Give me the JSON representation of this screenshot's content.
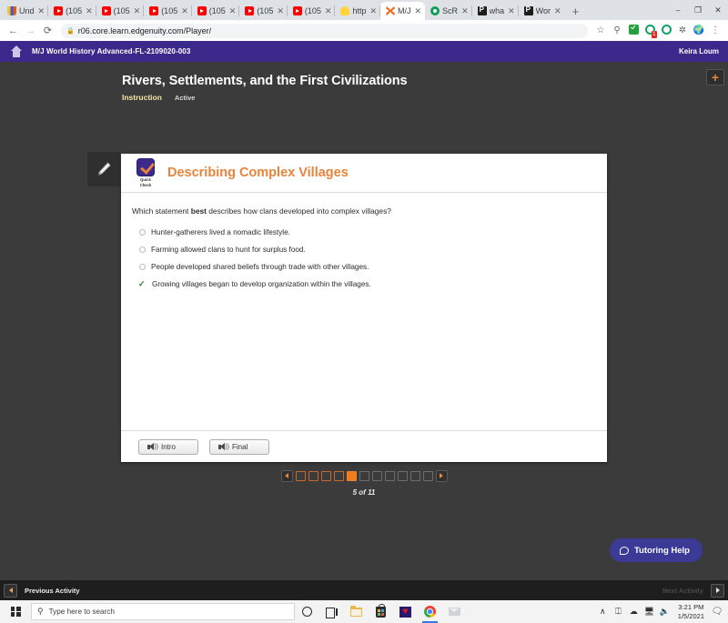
{
  "browser": {
    "tabs": [
      {
        "title": "Und",
        "favicon": "shopping-bag-icon",
        "active": false
      },
      {
        "title": "(105",
        "favicon": "youtube-icon",
        "active": false
      },
      {
        "title": "(105",
        "favicon": "youtube-icon",
        "active": false
      },
      {
        "title": "(105",
        "favicon": "youtube-icon",
        "active": false
      },
      {
        "title": "(105",
        "favicon": "youtube-icon",
        "active": false
      },
      {
        "title": "(105",
        "favicon": "youtube-icon",
        "active": false
      },
      {
        "title": "(105",
        "favicon": "youtube-icon",
        "active": false
      },
      {
        "title": "http",
        "favicon": "lightbulb-icon",
        "active": false
      },
      {
        "title": "M/J",
        "favicon": "edgenuity-icon",
        "active": true
      },
      {
        "title": "ScR",
        "favicon": "grammarly-icon",
        "active": false
      },
      {
        "title": "wha",
        "favicon": "pear-deck-icon",
        "active": false
      },
      {
        "title": "Wor",
        "favicon": "pear-deck-icon",
        "active": false
      }
    ],
    "new_tab_label": "+",
    "close_glyph": "✕",
    "window_controls": {
      "minimize": "–",
      "maximize": "❐",
      "close": "✕"
    },
    "nav": {
      "back": "←",
      "forward": "→",
      "reload": "⟳"
    },
    "omnibox": {
      "url": "r06.core.learn.edgenuity.com/Player/",
      "lock": "🔒"
    },
    "toolbar_icons": [
      "star-icon",
      "lens-icon",
      "green-check-extension-icon",
      "extension-badge-icon",
      "grammarly-extension-icon",
      "extensions-puzzle-icon",
      "profile-avatar-icon",
      "chrome-menu-icon"
    ],
    "extension_badge_count": "1"
  },
  "app": {
    "header": {
      "home_icon": "home-icon",
      "course_name": "M/J World History Advanced-FL-2109020-003",
      "user_name": "Keira Loum"
    },
    "lesson": {
      "title": "Rivers, Settlements, and the First Civilizations",
      "tabs": [
        {
          "label": "Instruction",
          "active": true
        },
        {
          "label": "Active",
          "active": false
        }
      ]
    },
    "add_button_label": "+",
    "pencil_tool": "pencil-icon",
    "card": {
      "badge_line1": "Quick",
      "badge_line2": "Check",
      "title": "Describing Complex Villages",
      "question_prefix": "Which statement ",
      "question_bold": "best",
      "question_suffix": " describes how clans developed into complex villages?",
      "options": [
        {
          "label": "Hunter-gatherers lived a nomadic lifestyle.",
          "state": "unselected"
        },
        {
          "label": "Farming allowed clans to hunt for surplus food.",
          "state": "unselected"
        },
        {
          "label": "People developed shared beliefs through trade with other villages.",
          "state": "unselected"
        },
        {
          "label": "Growing villages began to develop organization within the villages.",
          "state": "correct"
        }
      ],
      "footer_buttons": [
        {
          "label": "Intro",
          "icon": "speaker-icon"
        },
        {
          "label": "Final",
          "icon": "speaker-icon"
        }
      ]
    },
    "pager": {
      "prev_arrow": "prev-page-arrow",
      "next_arrow": "next-page-arrow",
      "total": 11,
      "current": 5,
      "label": "5 of 11"
    },
    "tutoring_help_label": "Tutoring Help",
    "activity_bar": {
      "previous_label": "Previous Activity",
      "next_label": "Next Activity"
    },
    "colors": {
      "purple_header": "#3b2a8c",
      "accent_orange": "#e8833a",
      "page_background": "#3b3b3b",
      "correct_green": "#2e7d32",
      "tutoring_blue": "#3b3a97"
    }
  },
  "taskbar": {
    "search_placeholder": "Type here to search",
    "search_icon": "search-icon",
    "apps": [
      "cortana-icon",
      "task-view-icon",
      "file-explorer-icon",
      "microsoft-store-icon",
      "heart-app-icon",
      "chrome-icon",
      "mail-icon"
    ],
    "tray_icons": [
      "show-hidden-icons-chevron",
      "onedrive-sync-icon",
      "onedrive-cloud-icon",
      "network-icon",
      "volume-icon"
    ],
    "clock_time": "3:21 PM",
    "clock_date": "1/5/2021",
    "notification_icon": "action-center-icon"
  }
}
